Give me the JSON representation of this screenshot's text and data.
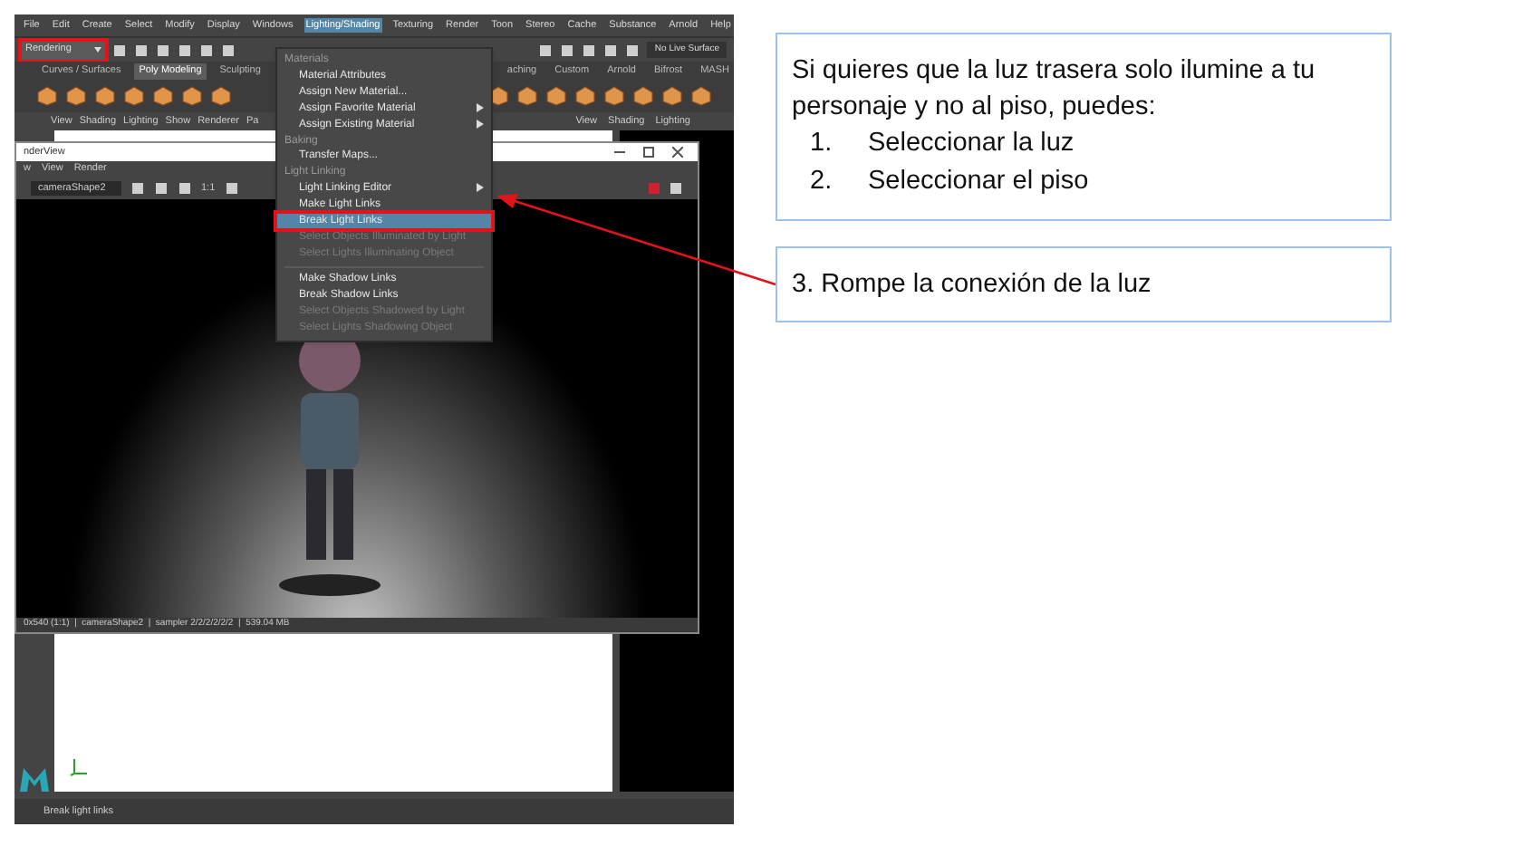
{
  "maya_window": {
    "menu_bar": [
      {
        "label": "File",
        "selected": false
      },
      {
        "label": "Edit",
        "selected": false
      },
      {
        "label": "Create",
        "selected": false
      },
      {
        "label": "Select",
        "selected": false
      },
      {
        "label": "Modify",
        "selected": false
      },
      {
        "label": "Display",
        "selected": false
      },
      {
        "label": "Windows",
        "selected": false
      },
      {
        "label": "Lighting/Shading",
        "selected": true
      },
      {
        "label": "Texturing",
        "selected": false
      },
      {
        "label": "Render",
        "selected": false
      },
      {
        "label": "Toon",
        "selected": false
      },
      {
        "label": "Stereo",
        "selected": false
      },
      {
        "label": "Cache",
        "selected": false
      },
      {
        "label": "Substance",
        "selected": false
      },
      {
        "label": "Arnold",
        "selected": false
      },
      {
        "label": "Help",
        "selected": false
      }
    ],
    "mode_dropdown": {
      "label": "Rendering",
      "highlighted": true
    },
    "live_surface_field": "No Live Surface",
    "shelf_tabs": [
      {
        "label": "Curves / Surfaces",
        "selected": false
      },
      {
        "label": "Poly Modeling",
        "selected": true
      },
      {
        "label": "Sculpting",
        "selected": false
      },
      {
        "label": "aching",
        "selected": false
      },
      {
        "label": "Custom",
        "selected": false
      },
      {
        "label": "Arnold",
        "selected": false
      },
      {
        "label": "Bifrost",
        "selected": false
      },
      {
        "label": "MASH",
        "selected": false
      }
    ],
    "panel_menu_left": [
      "View",
      "Shading",
      "Lighting",
      "Show",
      "Renderer",
      "Pa"
    ],
    "panel_menu_right": [
      "View",
      "Shading",
      "Lighting"
    ],
    "help_line": "Break light links"
  },
  "render_view": {
    "title": "nderView",
    "menu": [
      "w",
      "View",
      "Render"
    ],
    "camera_dropdown": "cameraShape2",
    "ratio_button": "1:1",
    "status": "0x540 (1:1)  |  cameraShape2  |  sampler 2/2/2/2/2/2  |  539.04 MB"
  },
  "dropdown_menu": {
    "items": [
      {
        "kind": "heading",
        "label": "Materials"
      },
      {
        "kind": "item",
        "label": "Material Attributes",
        "submenu": false,
        "disabled": false,
        "selected": false,
        "highlighted": false
      },
      {
        "kind": "item",
        "label": "Assign New Material...",
        "submenu": false,
        "disabled": false,
        "selected": false,
        "highlighted": false
      },
      {
        "kind": "item",
        "label": "Assign Favorite Material",
        "submenu": true,
        "disabled": false,
        "selected": false,
        "highlighted": false
      },
      {
        "kind": "item",
        "label": "Assign Existing Material",
        "submenu": true,
        "disabled": false,
        "selected": false,
        "highlighted": false
      },
      {
        "kind": "heading",
        "label": "Baking"
      },
      {
        "kind": "item",
        "label": "Transfer Maps...",
        "submenu": false,
        "disabled": false,
        "selected": false,
        "highlighted": false
      },
      {
        "kind": "heading",
        "label": "Light Linking"
      },
      {
        "kind": "item",
        "label": "Light Linking Editor",
        "submenu": true,
        "disabled": false,
        "selected": false,
        "highlighted": false
      },
      {
        "kind": "item",
        "label": "Make Light Links",
        "submenu": false,
        "disabled": false,
        "selected": false,
        "highlighted": false
      },
      {
        "kind": "item",
        "label": "Break Light Links",
        "submenu": false,
        "disabled": false,
        "selected": true,
        "highlighted": true
      },
      {
        "kind": "item",
        "label": "Select Objects Illuminated by Light",
        "submenu": false,
        "disabled": true,
        "selected": false,
        "highlighted": false
      },
      {
        "kind": "item",
        "label": "Select Lights Illuminating Object",
        "submenu": false,
        "disabled": true,
        "selected": false,
        "highlighted": false
      },
      {
        "kind": "separator"
      },
      {
        "kind": "item",
        "label": "Make Shadow Links",
        "submenu": false,
        "disabled": false,
        "selected": false,
        "highlighted": false
      },
      {
        "kind": "item",
        "label": "Break Shadow Links",
        "submenu": false,
        "disabled": false,
        "selected": false,
        "highlighted": false
      },
      {
        "kind": "item",
        "label": "Select Objects Shadowed by Light",
        "submenu": false,
        "disabled": true,
        "selected": false,
        "highlighted": false
      },
      {
        "kind": "item",
        "label": "Select Lights Shadowing Object",
        "submenu": false,
        "disabled": true,
        "selected": false,
        "highlighted": false
      }
    ]
  },
  "callouts": [
    {
      "text": "Si quieres que la luz trasera solo ilumine a tu personaje y no al piso, puedes:",
      "steps": [
        {
          "number": "1.",
          "text": "Seleccionar la luz"
        },
        {
          "number": "2.",
          "text": "Seleccionar el piso"
        }
      ]
    },
    {
      "text": "3. Rompe la conexión de la luz"
    }
  ]
}
